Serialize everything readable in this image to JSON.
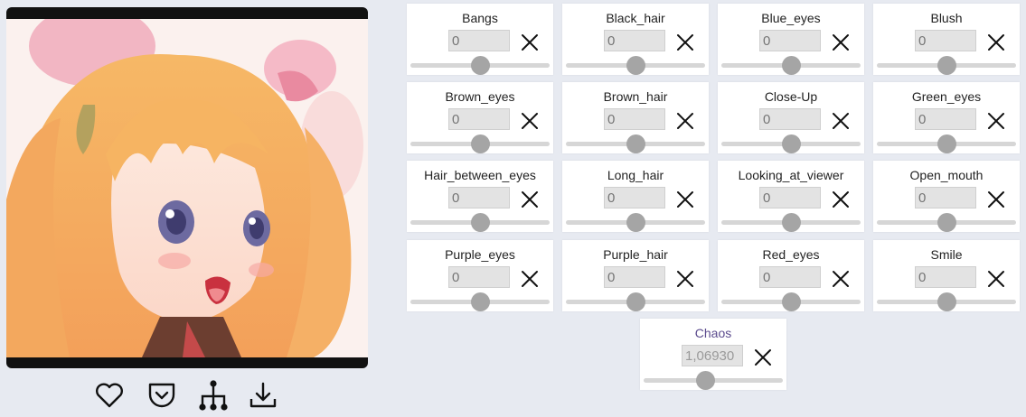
{
  "image": {
    "description_icon": "anime-portrait"
  },
  "actions": [
    {
      "name": "heart-icon"
    },
    {
      "name": "pocket-icon"
    },
    {
      "name": "tree-icon"
    },
    {
      "name": "download-icon"
    }
  ],
  "attributes": [
    {
      "label": "Bangs",
      "value": "",
      "placeholder": "0",
      "slider": 0.5
    },
    {
      "label": "Black_hair",
      "value": "",
      "placeholder": "0",
      "slider": 0.5
    },
    {
      "label": "Blue_eyes",
      "value": "",
      "placeholder": "0",
      "slider": 0.5
    },
    {
      "label": "Blush",
      "value": "",
      "placeholder": "0",
      "slider": 0.5
    },
    {
      "label": "Brown_eyes",
      "value": "",
      "placeholder": "0",
      "slider": 0.5
    },
    {
      "label": "Brown_hair",
      "value": "",
      "placeholder": "0",
      "slider": 0.5
    },
    {
      "label": "Close-Up",
      "value": "",
      "placeholder": "0",
      "slider": 0.5
    },
    {
      "label": "Green_eyes",
      "value": "",
      "placeholder": "0",
      "slider": 0.5
    },
    {
      "label": "Hair_between_eyes",
      "value": "",
      "placeholder": "0",
      "slider": 0.5
    },
    {
      "label": "Long_hair",
      "value": "",
      "placeholder": "0",
      "slider": 0.5
    },
    {
      "label": "Looking_at_viewer",
      "value": "",
      "placeholder": "0",
      "slider": 0.5
    },
    {
      "label": "Open_mouth",
      "value": "",
      "placeholder": "0",
      "slider": 0.5
    },
    {
      "label": "Purple_eyes",
      "value": "",
      "placeholder": "0",
      "slider": 0.5
    },
    {
      "label": "Purple_hair",
      "value": "",
      "placeholder": "0",
      "slider": 0.5
    },
    {
      "label": "Red_eyes",
      "value": "",
      "placeholder": "0",
      "slider": 0.5
    },
    {
      "label": "Smile",
      "value": "",
      "placeholder": "0",
      "slider": 0.5
    }
  ],
  "chaos": {
    "label": "Chaos",
    "value": "1,06930",
    "placeholder": "",
    "slider": 0.44
  },
  "colors": {
    "accent": "#5c4c8e",
    "thumb": "#a5a5a5",
    "track": "#d6d6d6",
    "background": "#e7eaf1"
  }
}
